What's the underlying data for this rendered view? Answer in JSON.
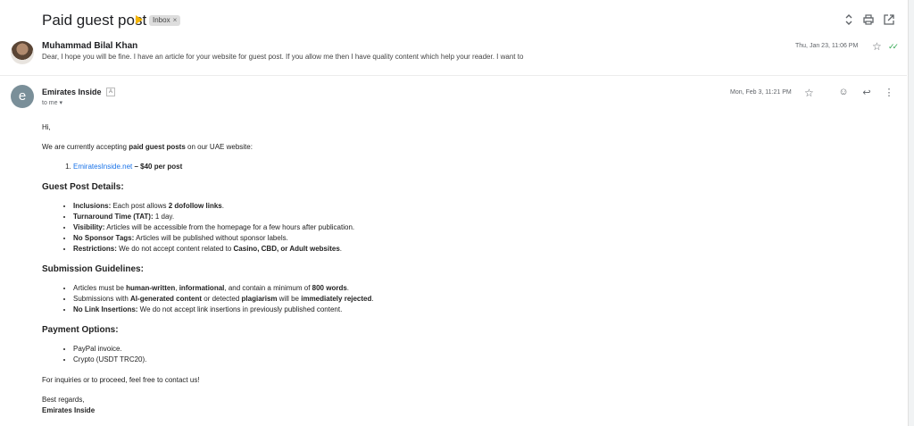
{
  "thread": {
    "subject": "Paid guest post",
    "label": "Inbox",
    "label_close": "×",
    "icons": [
      "expand-collapse-icon",
      "print-icon",
      "open-new-window-icon"
    ]
  },
  "message1": {
    "sender": "Muhammad Bilal Khan",
    "snippet": "Dear, I hope you will be fine. I have an article for your website for guest post. If you allow me then I have quality content which help your reader. I want to",
    "date": "Thu, Jan 23, 11:06 PM"
  },
  "message2": {
    "avatar_letter": "e",
    "sender": "Emirates Inside",
    "to": "to me ▾",
    "date": "Mon, Feb 3, 11:21 PM",
    "greeting": "Hi,",
    "intro_a": "We are currently accepting ",
    "intro_b": "paid guest posts",
    "intro_c": " on our UAE website:",
    "offer_link": "EmiratesInside.net",
    "offer_price": " – $40 per post",
    "details_heading": "Guest Post Details:",
    "details": [
      {
        "k": "Inclusions:",
        "v1": " Each post allows ",
        "b": "2 dofollow links",
        "v2": "."
      },
      {
        "k": "Turnaround Time (TAT):",
        "v1": " 1 day.",
        "b": "",
        "v2": ""
      },
      {
        "k": "Visibility:",
        "v1": " Articles will be accessible from the homepage for a few hours after publication.",
        "b": "",
        "v2": ""
      },
      {
        "k": "No Sponsor Tags:",
        "v1": " Articles will be published without sponsor labels.",
        "b": "",
        "v2": ""
      },
      {
        "k": "Restrictions:",
        "v1": " We do not accept content related to ",
        "b": "Casino, CBD, or Adult websites",
        "v2": "."
      }
    ],
    "guidelines_heading": "Submission Guidelines:",
    "g1": [
      "Articles must be ",
      "human-written",
      ", ",
      "informational",
      ", and contain a minimum of ",
      "800 words",
      "."
    ],
    "g2": [
      "Submissions with ",
      "AI-generated content",
      " or detected ",
      "plagiarism",
      " will be ",
      "immediately rejected",
      "."
    ],
    "g3": [
      "No Link Insertions:",
      " We do not accept link insertions in previously published content."
    ],
    "payment_heading": "Payment Options:",
    "payments": [
      "PayPal invoice.",
      "Crypto (USDT TRC20)."
    ],
    "closing": "For inquiries or to proceed, feel free to contact us!",
    "regards": "Best regards,",
    "signature": "Emirates Inside"
  }
}
